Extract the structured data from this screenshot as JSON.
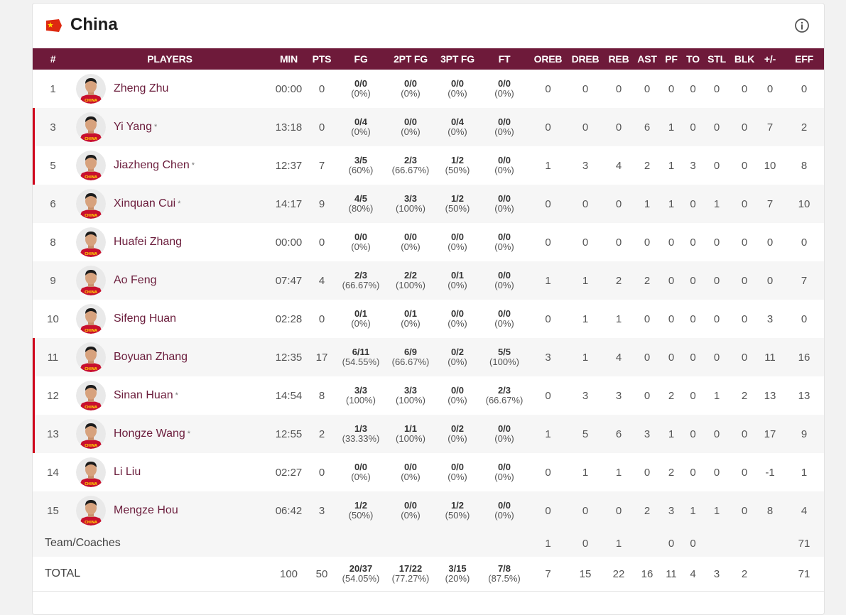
{
  "team": {
    "name": "China",
    "flag_icon": "china-flag-icon",
    "info_icon": "info-circle-icon"
  },
  "colors": {
    "header_bg": "#6e1a3a",
    "starter_marker": "#d0021b",
    "player_name": "#6b1d3c"
  },
  "columns": [
    "#",
    "PLAYERS",
    "MIN",
    "PTS",
    "FG",
    "2PT FG",
    "3PT FG",
    "FT",
    "OREB",
    "DREB",
    "REB",
    "AST",
    "PF",
    "TO",
    "STL",
    "BLK",
    "+/-",
    "EFF"
  ],
  "players": [
    {
      "num": "1",
      "name": "Zheng Zhu",
      "star": "",
      "min": "00:00",
      "pts": "0",
      "fg": [
        "0/0",
        "(0%)"
      ],
      "fg2": [
        "0/0",
        "(0%)"
      ],
      "fg3": [
        "0/0",
        "(0%)"
      ],
      "ft": [
        "0/0",
        "(0%)"
      ],
      "oreb": "0",
      "dreb": "0",
      "reb": "0",
      "ast": "0",
      "pf": "0",
      "to": "0",
      "stl": "0",
      "blk": "0",
      "pm": "0",
      "eff": "0"
    },
    {
      "num": "3",
      "name": "Yi Yang",
      "star": "*",
      "min": "13:18",
      "pts": "0",
      "fg": [
        "0/4",
        "(0%)"
      ],
      "fg2": [
        "0/0",
        "(0%)"
      ],
      "fg3": [
        "0/4",
        "(0%)"
      ],
      "ft": [
        "0/0",
        "(0%)"
      ],
      "oreb": "0",
      "dreb": "0",
      "reb": "0",
      "ast": "6",
      "pf": "1",
      "to": "0",
      "stl": "0",
      "blk": "0",
      "pm": "7",
      "eff": "2"
    },
    {
      "num": "5",
      "name": "Jiazheng Chen",
      "star": "*",
      "min": "12:37",
      "pts": "7",
      "fg": [
        "3/5",
        "(60%)"
      ],
      "fg2": [
        "2/3",
        "(66.67%)"
      ],
      "fg3": [
        "1/2",
        "(50%)"
      ],
      "ft": [
        "0/0",
        "(0%)"
      ],
      "oreb": "1",
      "dreb": "3",
      "reb": "4",
      "ast": "2",
      "pf": "1",
      "to": "3",
      "stl": "0",
      "blk": "0",
      "pm": "10",
      "eff": "8"
    },
    {
      "num": "6",
      "name": "Xinquan Cui",
      "star": "*",
      "min": "14:17",
      "pts": "9",
      "fg": [
        "4/5",
        "(80%)"
      ],
      "fg2": [
        "3/3",
        "(100%)"
      ],
      "fg3": [
        "1/2",
        "(50%)"
      ],
      "ft": [
        "0/0",
        "(0%)"
      ],
      "oreb": "0",
      "dreb": "0",
      "reb": "0",
      "ast": "1",
      "pf": "1",
      "to": "0",
      "stl": "1",
      "blk": "0",
      "pm": "7",
      "eff": "10"
    },
    {
      "num": "8",
      "name": "Huafei Zhang",
      "star": "",
      "min": "00:00",
      "pts": "0",
      "fg": [
        "0/0",
        "(0%)"
      ],
      "fg2": [
        "0/0",
        "(0%)"
      ],
      "fg3": [
        "0/0",
        "(0%)"
      ],
      "ft": [
        "0/0",
        "(0%)"
      ],
      "oreb": "0",
      "dreb": "0",
      "reb": "0",
      "ast": "0",
      "pf": "0",
      "to": "0",
      "stl": "0",
      "blk": "0",
      "pm": "0",
      "eff": "0"
    },
    {
      "num": "9",
      "name": "Ao Feng",
      "star": "",
      "min": "07:47",
      "pts": "4",
      "fg": [
        "2/3",
        "(66.67%)"
      ],
      "fg2": [
        "2/2",
        "(100%)"
      ],
      "fg3": [
        "0/1",
        "(0%)"
      ],
      "ft": [
        "0/0",
        "(0%)"
      ],
      "oreb": "1",
      "dreb": "1",
      "reb": "2",
      "ast": "2",
      "pf": "0",
      "to": "0",
      "stl": "0",
      "blk": "0",
      "pm": "0",
      "eff": "7"
    },
    {
      "num": "10",
      "name": "Sifeng Huan",
      "star": "",
      "min": "02:28",
      "pts": "0",
      "fg": [
        "0/1",
        "(0%)"
      ],
      "fg2": [
        "0/1",
        "(0%)"
      ],
      "fg3": [
        "0/0",
        "(0%)"
      ],
      "ft": [
        "0/0",
        "(0%)"
      ],
      "oreb": "0",
      "dreb": "1",
      "reb": "1",
      "ast": "0",
      "pf": "0",
      "to": "0",
      "stl": "0",
      "blk": "0",
      "pm": "3",
      "eff": "0"
    },
    {
      "num": "11",
      "name": "Boyuan Zhang",
      "star": "",
      "min": "12:35",
      "pts": "17",
      "fg": [
        "6/11",
        "(54.55%)"
      ],
      "fg2": [
        "6/9",
        "(66.67%)"
      ],
      "fg3": [
        "0/2",
        "(0%)"
      ],
      "ft": [
        "5/5",
        "(100%)"
      ],
      "oreb": "3",
      "dreb": "1",
      "reb": "4",
      "ast": "0",
      "pf": "0",
      "to": "0",
      "stl": "0",
      "blk": "0",
      "pm": "11",
      "eff": "16"
    },
    {
      "num": "12",
      "name": "Sinan Huan",
      "star": "*",
      "min": "14:54",
      "pts": "8",
      "fg": [
        "3/3",
        "(100%)"
      ],
      "fg2": [
        "3/3",
        "(100%)"
      ],
      "fg3": [
        "0/0",
        "(0%)"
      ],
      "ft": [
        "2/3",
        "(66.67%)"
      ],
      "oreb": "0",
      "dreb": "3",
      "reb": "3",
      "ast": "0",
      "pf": "2",
      "to": "0",
      "stl": "1",
      "blk": "2",
      "pm": "13",
      "eff": "13"
    },
    {
      "num": "13",
      "name": "Hongze Wang",
      "star": "*",
      "min": "12:55",
      "pts": "2",
      "fg": [
        "1/3",
        "(33.33%)"
      ],
      "fg2": [
        "1/1",
        "(100%)"
      ],
      "fg3": [
        "0/2",
        "(0%)"
      ],
      "ft": [
        "0/0",
        "(0%)"
      ],
      "oreb": "1",
      "dreb": "5",
      "reb": "6",
      "ast": "3",
      "pf": "1",
      "to": "0",
      "stl": "0",
      "blk": "0",
      "pm": "17",
      "eff": "9"
    },
    {
      "num": "14",
      "name": "Li Liu",
      "star": "",
      "min": "02:27",
      "pts": "0",
      "fg": [
        "0/0",
        "(0%)"
      ],
      "fg2": [
        "0/0",
        "(0%)"
      ],
      "fg3": [
        "0/0",
        "(0%)"
      ],
      "ft": [
        "0/0",
        "(0%)"
      ],
      "oreb": "0",
      "dreb": "1",
      "reb": "1",
      "ast": "0",
      "pf": "2",
      "to": "0",
      "stl": "0",
      "blk": "0",
      "pm": "-1",
      "eff": "1"
    },
    {
      "num": "15",
      "name": "Mengze Hou",
      "star": "",
      "min": "06:42",
      "pts": "3",
      "fg": [
        "1/2",
        "(50%)"
      ],
      "fg2": [
        "0/0",
        "(0%)"
      ],
      "fg3": [
        "1/2",
        "(50%)"
      ],
      "ft": [
        "0/0",
        "(0%)"
      ],
      "oreb": "0",
      "dreb": "0",
      "reb": "0",
      "ast": "2",
      "pf": "3",
      "to": "1",
      "stl": "1",
      "blk": "0",
      "pm": "8",
      "eff": "4"
    }
  ],
  "starter_rows": [
    1,
    2,
    7,
    8,
    9
  ],
  "team_row": {
    "label": "Team/Coaches",
    "oreb": "1",
    "dreb": "0",
    "reb": "1",
    "ast": "",
    "pf": "0",
    "to": "0",
    "stl": "",
    "blk": "",
    "pm": "",
    "eff": "71"
  },
  "total_row": {
    "label": "TOTAL",
    "min": "100",
    "pts": "50",
    "fg": [
      "20/37",
      "(54.05%)"
    ],
    "fg2": [
      "17/22",
      "(77.27%)"
    ],
    "fg3": [
      "3/15",
      "(20%)"
    ],
    "ft": [
      "7/8",
      "(87.5%)"
    ],
    "oreb": "7",
    "dreb": "15",
    "reb": "22",
    "ast": "16",
    "pf": "11",
    "to": "4",
    "stl": "3",
    "blk": "2",
    "pm": "",
    "eff": "71"
  }
}
